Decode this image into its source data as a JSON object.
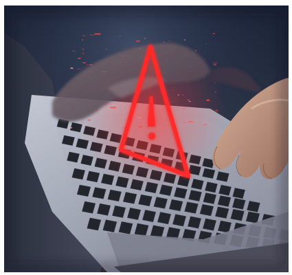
{
  "image": {
    "subject": "laptop-keyboard-typing-with-warning-sign",
    "icon": "warning-triangle-icon",
    "colors": {
      "background_top": "#1c2438",
      "background_bottom": "#3b3240",
      "warning_red": "#ff2b2b",
      "glow_red": "#ff4040",
      "laptop_body": "#a9aebb",
      "keys": "#23252d",
      "skin": "#c9a088"
    }
  }
}
